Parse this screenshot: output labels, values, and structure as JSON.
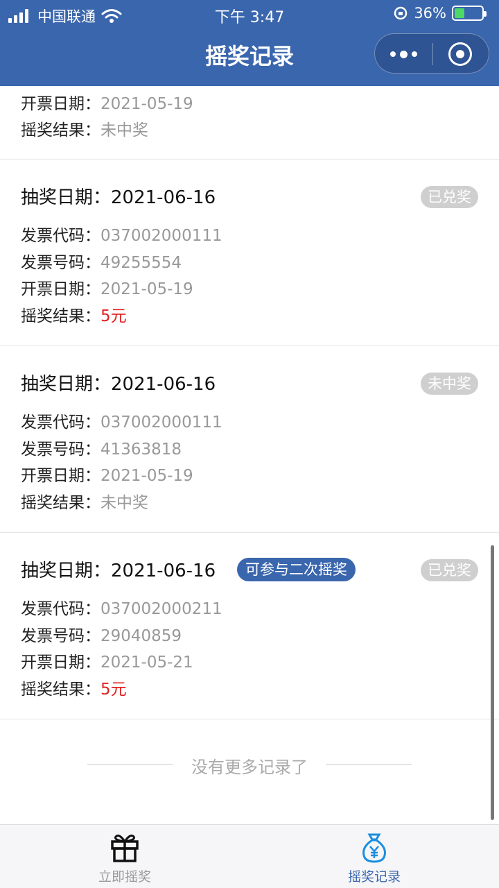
{
  "status_bar": {
    "carrier": "中国联通",
    "time": "下午 3:47",
    "battery": "36%"
  },
  "header": {
    "title": "摇奖记录"
  },
  "labels": {
    "draw_date": "抽奖日期：",
    "invoice_code": "发票代码：",
    "invoice_number": "发票号码：",
    "issue_date": "开票日期：",
    "result": "摇奖结果："
  },
  "partial": {
    "issue_date": "2021-05-19",
    "result": "未中奖"
  },
  "records": [
    {
      "draw_date": "2021-06-16",
      "invoice_code": "037002000111",
      "invoice_number": "49255554",
      "issue_date": "2021-05-19",
      "result": "5元",
      "status": "已兑奖",
      "second": ""
    },
    {
      "draw_date": "2021-06-16",
      "invoice_code": "037002000111",
      "invoice_number": "41363818",
      "issue_date": "2021-05-19",
      "result": "未中奖",
      "status": "未中奖",
      "second": ""
    },
    {
      "draw_date": "2021-06-16",
      "invoice_code": "037002000211",
      "invoice_number": "29040859",
      "issue_date": "2021-05-21",
      "result": "5元",
      "status": "已兑奖",
      "second": "可参与二次摇奖"
    }
  ],
  "footer": {
    "no_more": "没有更多记录了"
  },
  "tabs": [
    {
      "label": "立即摇奖",
      "icon": "gift-icon"
    },
    {
      "label": "摇奖记录",
      "icon": "money-bag-icon"
    }
  ],
  "colors": {
    "accent": "#3a66ad",
    "win": "#e02020",
    "muted": "#999999"
  }
}
